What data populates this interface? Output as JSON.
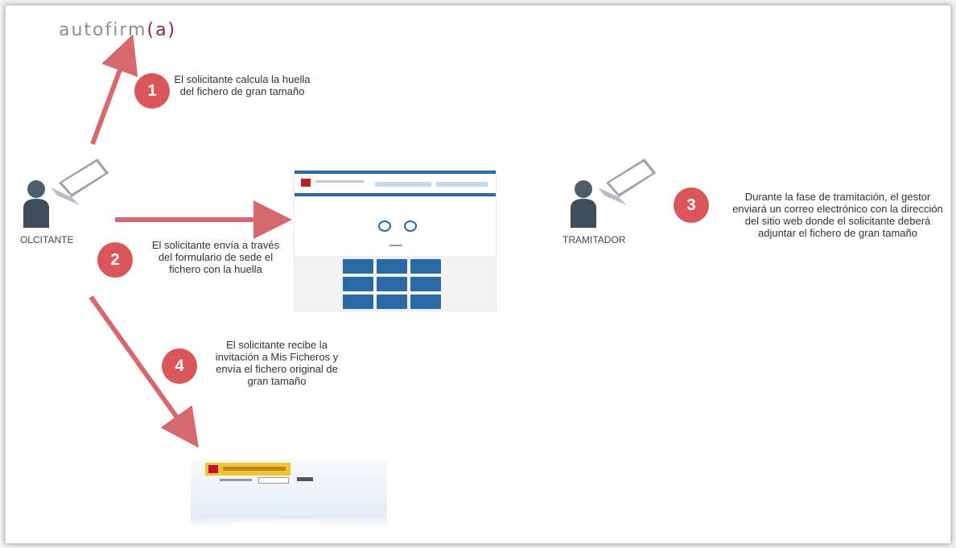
{
  "logo": {
    "text_main": "autofirm",
    "text_accent": "a"
  },
  "steps": [
    {
      "number": "1",
      "text": "El solicitante calcula la huella del fichero de gran tamaño"
    },
    {
      "number": "2",
      "text": "El solicitante envía a través del formulario de sede el fichero con la huella"
    },
    {
      "number": "3",
      "text": "Durante la fase de tramitación, el gestor enviará un correo electrónico con la dirección del sitio web donde el solicitante deberá adjuntar el fichero de gran tamaño"
    },
    {
      "number": "4",
      "text": "El solicitante recibe la invitación a Mis Ficheros y envía el fichero original de gran tamaño"
    }
  ],
  "actors": {
    "solicitante": "OLCITANTE",
    "tramitador": "TRAMITADOR"
  },
  "colors": {
    "arrow": "#d46a6f",
    "step_circle": "#d9565a",
    "tile": "#2c68a6",
    "logo_accent": "#8a2a3a"
  },
  "icons": [
    "person-icon",
    "laptop-icon",
    "arrow-icon"
  ]
}
